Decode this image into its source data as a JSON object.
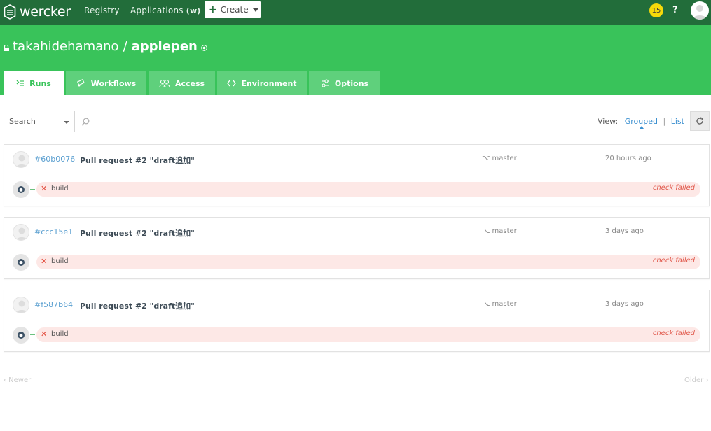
{
  "topnav": {
    "brand": "wercker",
    "registry": "Registry",
    "applications": "Applications",
    "applications_suffix": "(w)",
    "create": "Create",
    "notifications": "15",
    "help": "?"
  },
  "repo": {
    "owner": "takahidehamano",
    "separator": "/",
    "name": "applepen"
  },
  "tabs": [
    {
      "label": "Runs",
      "active": true
    },
    {
      "label": "Workflows",
      "active": false
    },
    {
      "label": "Access",
      "active": false
    },
    {
      "label": "Environment",
      "active": false
    },
    {
      "label": "Options",
      "active": false
    }
  ],
  "filter": {
    "select_value": "Search",
    "input_value": "",
    "view_label": "View:",
    "grouped": "Grouped",
    "divider": "|",
    "list": "List"
  },
  "runs": [
    {
      "hash": "#60b0076",
      "message": "Pull request #2 \"draft追加\"",
      "branch": "master",
      "time": "20 hours ago",
      "step": "build",
      "status": "check failed"
    },
    {
      "hash": "#ccc15e1",
      "message": "Pull request #2 \"draft追加\"",
      "branch": "master",
      "time": "3 days ago",
      "step": "build",
      "status": "check failed"
    },
    {
      "hash": "#f587b64",
      "message": "Pull request #2 \"draft追加\"",
      "branch": "master",
      "time": "3 days ago",
      "step": "build",
      "status": "check failed"
    }
  ],
  "pager": {
    "newer": "‹ Newer",
    "older": "Older ›"
  },
  "colors": {
    "nav": "#226d3a",
    "hero": "#39c35a",
    "tab": "#5fd07c",
    "link": "#3a8fd0",
    "fail_bg": "#fde8e6",
    "fail_text": "#e0574a",
    "badge": "#f5d90a"
  },
  "icons": {
    "brand": "wercker-logo-icon",
    "lock": "lock-icon",
    "github": "github-icon",
    "runs": "runs-icon",
    "workflows": "workflows-icon",
    "access": "access-icon",
    "environment": "code-icon",
    "options": "sliders-icon",
    "search": "search-icon",
    "refresh": "refresh-icon",
    "branch": "branch-icon",
    "fail": "x-icon"
  }
}
